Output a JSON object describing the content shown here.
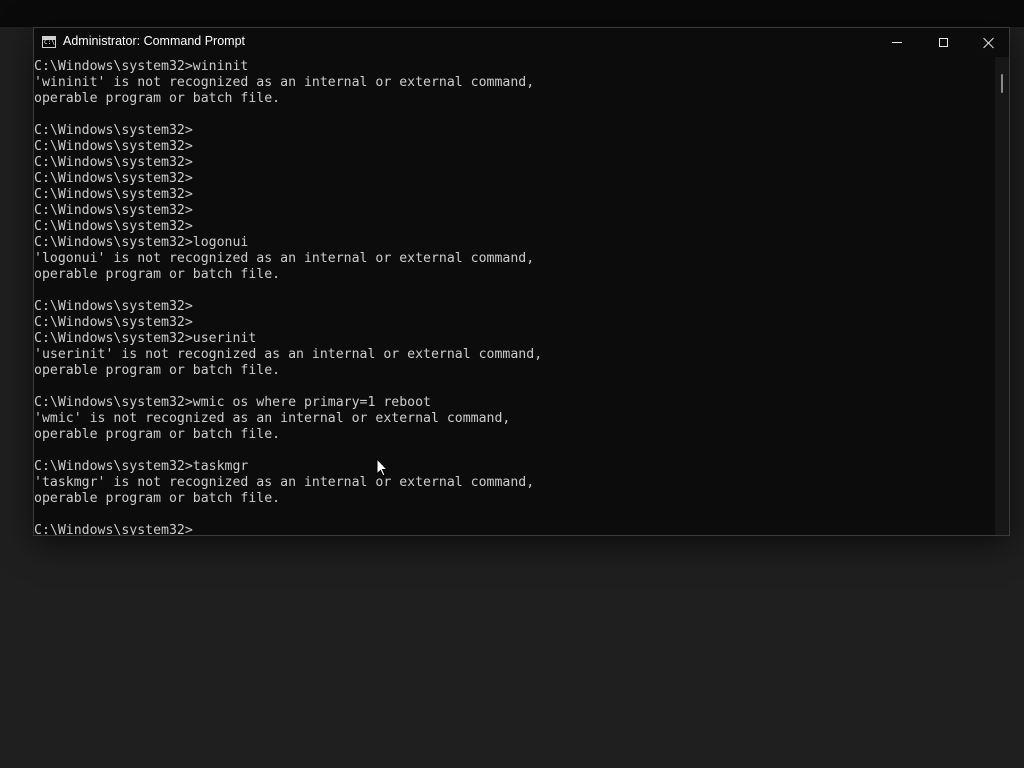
{
  "window": {
    "title": "Administrator: Command Prompt",
    "icon": "command-prompt-icon",
    "icon_text": "C:\\",
    "controls": [
      "minimize-icon",
      "maximize-icon",
      "close-icon"
    ]
  },
  "console": {
    "lines": [
      "C:\\Windows\\system32>wininit",
      "'wininit' is not recognized as an internal or external command,",
      "operable program or batch file.",
      "",
      "C:\\Windows\\system32>",
      "C:\\Windows\\system32>",
      "C:\\Windows\\system32>",
      "C:\\Windows\\system32>",
      "C:\\Windows\\system32>",
      "C:\\Windows\\system32>",
      "C:\\Windows\\system32>",
      "C:\\Windows\\system32>logonui",
      "'logonui' is not recognized as an internal or external command,",
      "operable program or batch file.",
      "",
      "C:\\Windows\\system32>",
      "C:\\Windows\\system32>",
      "C:\\Windows\\system32>userinit",
      "'userinit' is not recognized as an internal or external command,",
      "operable program or batch file.",
      "",
      "C:\\Windows\\system32>wmic os where primary=1 reboot",
      "'wmic' is not recognized as an internal or external command,",
      "operable program or batch file.",
      "",
      "C:\\Windows\\system32>taskmgr",
      "'taskmgr' is not recognized as an internal or external command,",
      "operable program or batch file.",
      "",
      "C:\\Windows\\system32>"
    ]
  },
  "colors": {
    "console_bg": "#0c0c0c",
    "console_text": "#cccccc",
    "desktop_bg": "#1f1f1f"
  }
}
